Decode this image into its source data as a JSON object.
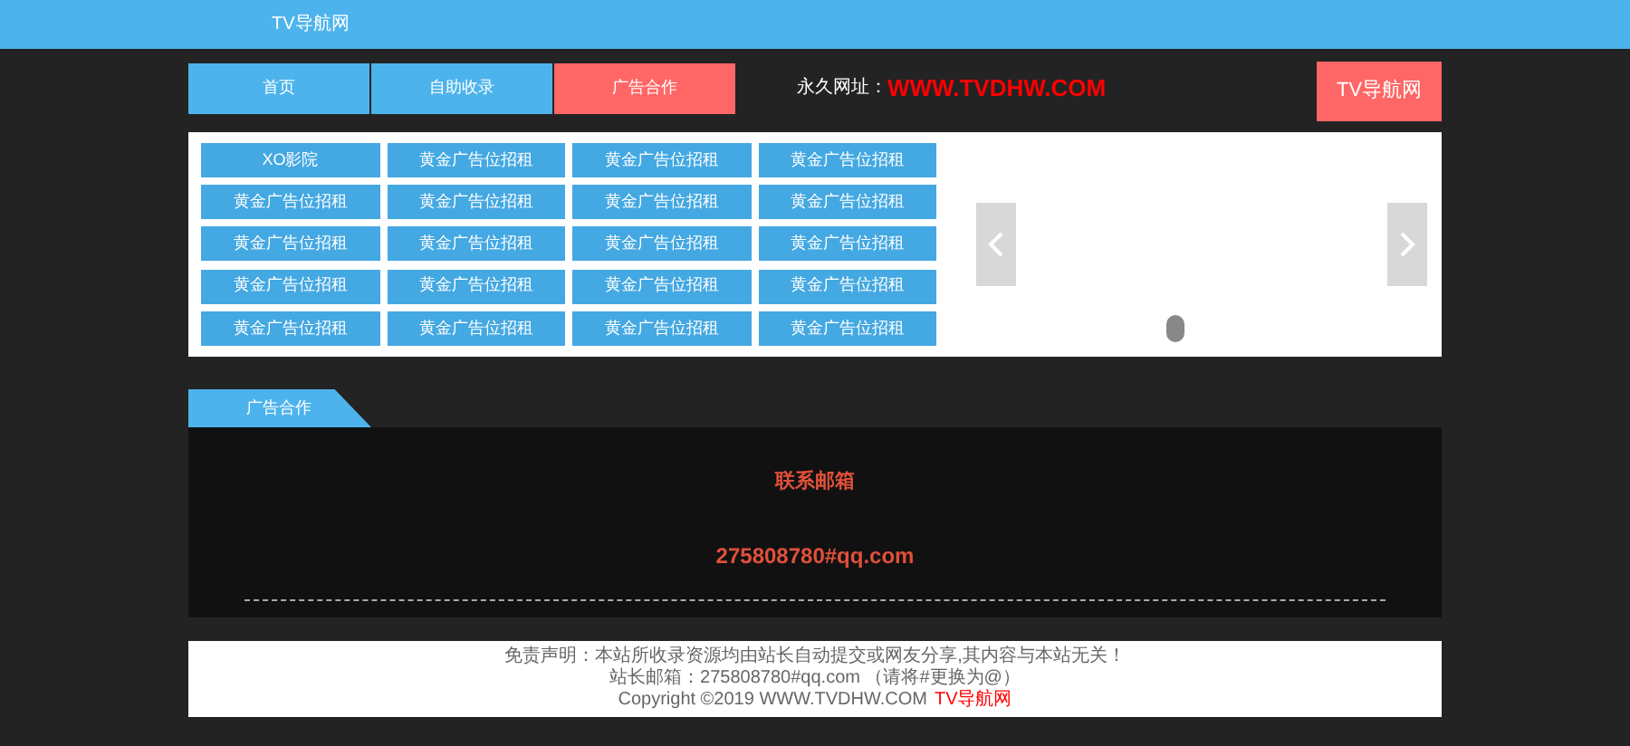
{
  "header": {
    "title": "TV导航网"
  },
  "nav": [
    {
      "label": "首页",
      "selected": false
    },
    {
      "label": "自助收录",
      "selected": false
    },
    {
      "label": "广告合作",
      "selected": true
    }
  ],
  "permanent_url": {
    "label": "永久网址：",
    "url": "WWW.TVDHW.COM"
  },
  "brand_button": "TV导航网",
  "link_grid": [
    "XO影院",
    "黄金广告位招租",
    "黄金广告位招租",
    "黄金广告位招租",
    "黄金广告位招租",
    "黄金广告位招租",
    "黄金广告位招租",
    "黄金广告位招租",
    "黄金广告位招租",
    "黄金广告位招租",
    "黄金广告位招租",
    "黄金广告位招租",
    "黄金广告位招租",
    "黄金广告位招租",
    "黄金广告位招租",
    "黄金广告位招租",
    "黄金广告位招租",
    "黄金广告位招租",
    "黄金广告位招租",
    "黄金广告位招租"
  ],
  "section": {
    "tab": "广告合作",
    "contact_label": "联系邮箱",
    "email": "275808780#qq.com"
  },
  "footer": {
    "disclaimer": "免责声明：本站所收录资源均由站长自动提交或网友分享,其内容与本站无关！",
    "webmaster_email": "站长邮箱：275808780#qq.com （请将#更换为@）",
    "copyright": "Copyright ©2019 WWW.TVDHW.COM",
    "brand": "TV导航网"
  }
}
